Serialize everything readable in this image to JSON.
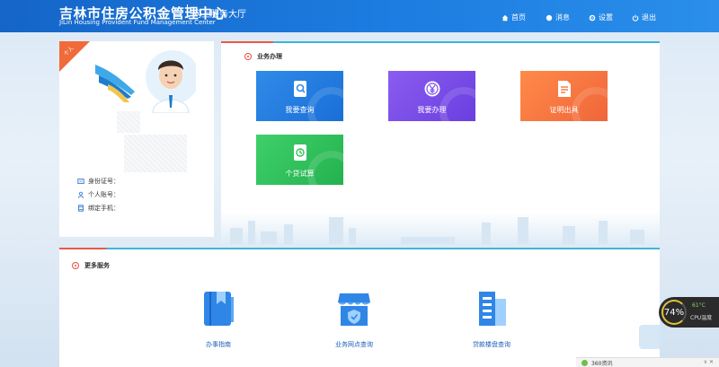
{
  "header": {
    "title_cn": "吉林市住房公积金管理中心",
    "title_sub": "网上服务大厅",
    "title_en": "JiLin Housing Provident Fund Management Center",
    "nav": [
      {
        "label": "首页",
        "icon": "home-icon"
      },
      {
        "label": "消息",
        "icon": "message-icon"
      },
      {
        "label": "设置",
        "icon": "gear-icon"
      },
      {
        "label": "退出",
        "icon": "power-icon"
      }
    ]
  },
  "profile": {
    "corner_tag": "个人",
    "fields": [
      {
        "label": "身份证号：",
        "icon": "id-card-icon"
      },
      {
        "label": "个人账号：",
        "icon": "user-icon"
      },
      {
        "label": "绑定手机：",
        "icon": "phone-icon"
      }
    ]
  },
  "business": {
    "title": "业务办理",
    "tiles": [
      {
        "label": "我要查询",
        "icon": "search-doc-icon",
        "color": "#2f8be8"
      },
      {
        "label": "我要办理",
        "icon": "yuan-icon",
        "color": "#7c4ef0"
      },
      {
        "label": "证明出具",
        "icon": "document-icon",
        "color": "#f5743f"
      },
      {
        "label": "个贷试算",
        "icon": "calculator-icon",
        "color": "#33c25c"
      }
    ]
  },
  "more": {
    "title": "更多服务",
    "items": [
      {
        "label": "办事指南",
        "icon": "guide-book-icon"
      },
      {
        "label": "业务网点查询",
        "icon": "branch-shop-icon"
      },
      {
        "label": "贷款楼盘查询",
        "icon": "building-icon"
      }
    ]
  },
  "overlay": {
    "cpu_percent": "74%",
    "cpu_temp": "61°C",
    "cpu_label": "CPU温度",
    "news_label": "360资讯",
    "news_controls": "∨  ✕"
  },
  "colors": {
    "header_blue": "#1d7de0",
    "accent_red": "#e85a45",
    "accent_cyan": "#3fb6d8",
    "link_blue": "#1c5fb8"
  }
}
